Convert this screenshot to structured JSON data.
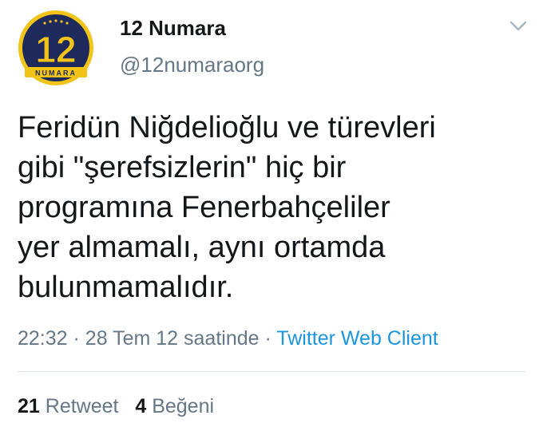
{
  "account": {
    "avatar_number": "12",
    "avatar_brand": "NUMARA",
    "display_name": "12 Numara",
    "handle": "@12numaraorg"
  },
  "tweet": {
    "text": "Feridün Niğdelioğlu ve türevleri\ngibi \"şerefsizlerin\" hiç bir\nprogramına Fenerbahçeliler\nyer almamalı, aynı ortamda\nbulunmamalıdır.",
    "time": "22:32",
    "date": "28 Tem 12 saatinde",
    "separator": "·",
    "source": "Twitter Web Client"
  },
  "stats": {
    "retweets_count": "21",
    "retweets_label": "Retweet",
    "likes_count": "4",
    "likes_label": "Beğeni"
  },
  "icons": {
    "menu": "chevron-down-icon"
  },
  "colors": {
    "avatar_navy": "#1f2a5c",
    "avatar_gold": "#f2c417",
    "link_blue": "#1b95e0",
    "secondary_text": "#657786"
  }
}
